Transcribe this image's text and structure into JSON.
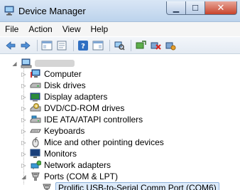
{
  "window": {
    "title": "Device Manager",
    "icon": "computer-manage-icon",
    "min_glyph": "▁",
    "max_glyph": "☐",
    "close_glyph": "✕"
  },
  "menu": {
    "file": "File",
    "action": "Action",
    "view": "View",
    "help": "Help"
  },
  "toolbar": {
    "buttons": [
      "back-icon",
      "forward-icon",
      "show-hide-console-tree-icon",
      "properties-icon",
      "help-icon",
      "show-hidden-icon",
      "scan-hardware-icon",
      "update-driver-icon",
      "uninstall-icon",
      "disable-icon"
    ]
  },
  "tree": {
    "root_label": "",
    "root_expander": "◢",
    "collapsed_glyph": "▷",
    "expanded_glyph": "◢",
    "items": [
      {
        "label": "Computer",
        "icon": "computer-icon"
      },
      {
        "label": "Disk drives",
        "icon": "disk-drive-icon"
      },
      {
        "label": "Display adapters",
        "icon": "display-adapter-icon"
      },
      {
        "label": "DVD/CD-ROM drives",
        "icon": "dvd-drive-icon"
      },
      {
        "label": "IDE ATA/ATAPI controllers",
        "icon": "ide-controller-icon"
      },
      {
        "label": "Keyboards",
        "icon": "keyboard-icon"
      },
      {
        "label": "Mice and other pointing devices",
        "icon": "mouse-icon"
      },
      {
        "label": "Monitors",
        "icon": "monitor-icon"
      },
      {
        "label": "Network adapters",
        "icon": "network-adapter-icon"
      },
      {
        "label": "Ports (COM & LPT)",
        "icon": "port-icon"
      }
    ],
    "child": {
      "label": "Prolific USB-to-Serial Comm Port (COM6)",
      "icon": "port-icon"
    }
  }
}
